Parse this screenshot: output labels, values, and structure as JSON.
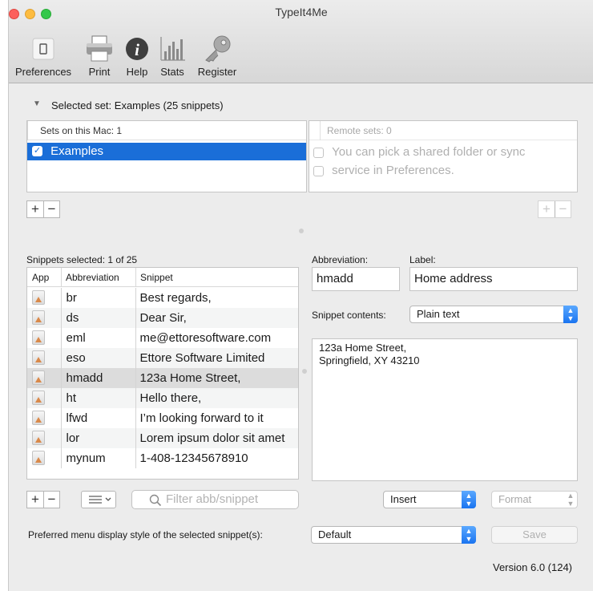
{
  "window": {
    "title": "TypeIt4Me"
  },
  "toolbar": {
    "items": [
      {
        "label": "Preferences",
        "icon": "preferences-icon"
      },
      {
        "label": "Print",
        "icon": "printer-icon"
      },
      {
        "label": "Help",
        "icon": "info-icon"
      },
      {
        "label": "Stats",
        "icon": "stats-icon"
      },
      {
        "label": "Register",
        "icon": "key-icon"
      }
    ]
  },
  "sets": {
    "disclosure_label": "Selected set:",
    "disclosure_value": "Examples (25 snippets)",
    "local_header": "Sets on this Mac: 1",
    "local_items": [
      {
        "label": "Examples",
        "checked": true,
        "selected": true
      }
    ],
    "remote_header": "Remote sets: 0",
    "remote_lines": [
      "You can pick a shared folder or sync",
      "service in Preferences."
    ],
    "add": "+",
    "remove": "−"
  },
  "snippets": {
    "selected_count": "Snippets selected: 1 of 25",
    "columns": {
      "app": "App",
      "abbreviation": "Abbreviation",
      "snippet": "Snippet"
    },
    "rows": [
      {
        "abbreviation": "br",
        "snippet": "Best regards,"
      },
      {
        "abbreviation": "ds",
        "snippet": "Dear Sir,"
      },
      {
        "abbreviation": "eml",
        "snippet": "me@ettoresoftware.com"
      },
      {
        "abbreviation": "eso",
        "snippet": "Ettore Software Limited"
      },
      {
        "abbreviation": "hmadd",
        "snippet": "123a Home Street,",
        "selected": true
      },
      {
        "abbreviation": "ht",
        "snippet": "Hello there,"
      },
      {
        "abbreviation": "lfwd",
        "snippet": "I’m looking forward to it"
      },
      {
        "abbreviation": "lor",
        "snippet": "Lorem ipsum dolor sit amet"
      },
      {
        "abbreviation": "mynum",
        "snippet": "1-408-12345678910"
      }
    ],
    "filter_placeholder": "Filter abb/snippet",
    "add": "+",
    "remove": "−"
  },
  "editor": {
    "abbreviation_label": "Abbreviation:",
    "abbreviation_value": "hmadd",
    "label_label": "Label:",
    "label_value": "Home address",
    "contents_label": "Snippet contents:",
    "contents_type": "Plain text",
    "contents_lines": [
      "123a Home Street,",
      "Springfield, XY 43210"
    ],
    "insert": "Insert",
    "format": "Format"
  },
  "footer": {
    "menu_style_label": "Preferred menu display style of the selected snippet(s):",
    "menu_style_value": "Default",
    "save": "Save",
    "version": "Version 6.0 (124)"
  },
  "colors": {
    "selection": "#1a6ed8",
    "accent": "#1a74f0"
  }
}
